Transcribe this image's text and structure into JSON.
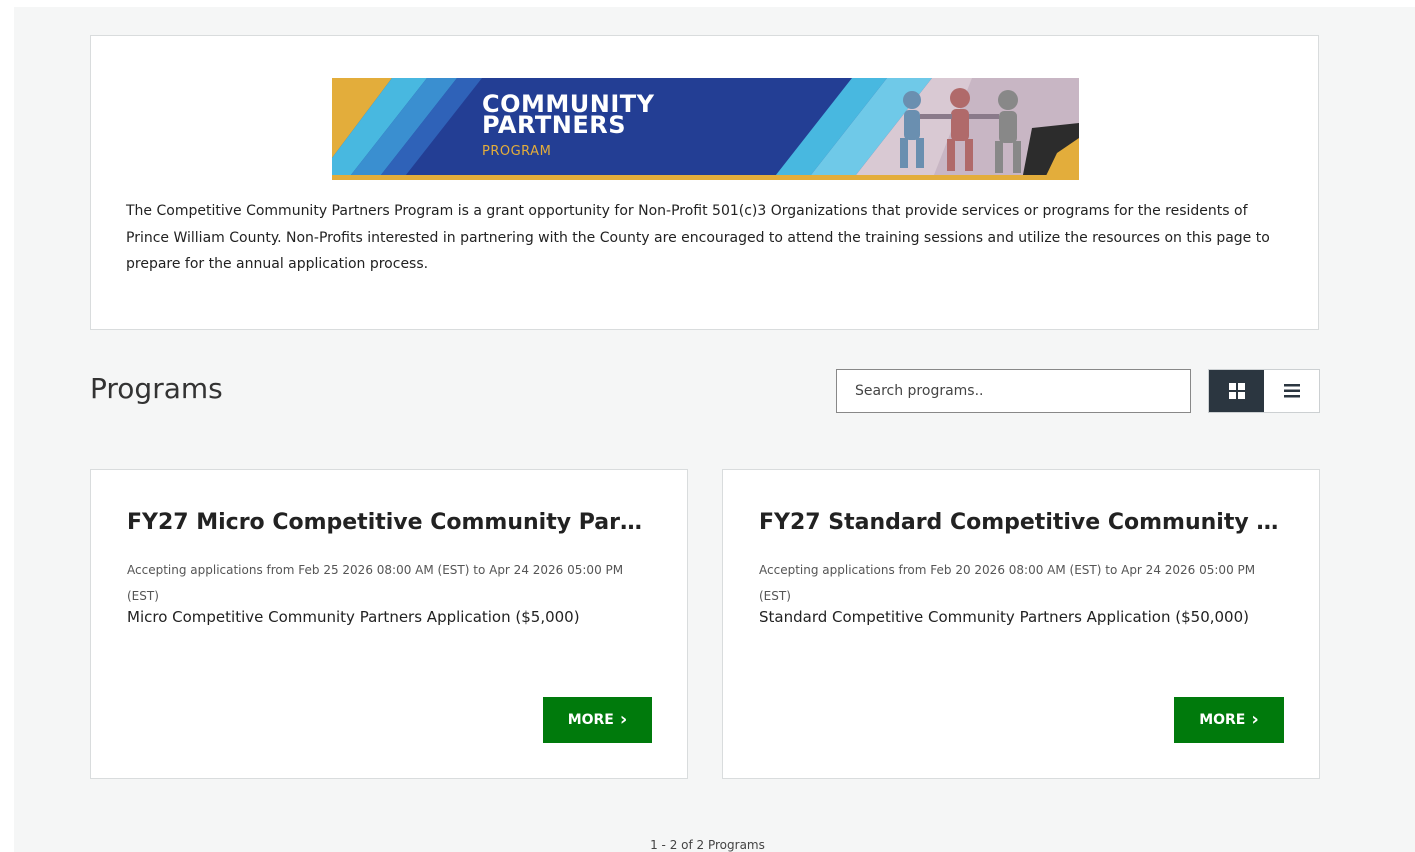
{
  "banner": {
    "title_line1": "COMMUNITY",
    "title_line2": "PARTNERS",
    "subtitle": "PROGRAM",
    "colors": {
      "navy": "#233e94",
      "gold": "#e3ad3b",
      "light_blue": "#48b8e0"
    }
  },
  "intro": {
    "text": "The Competitive Community Partners Program is a grant opportunity for Non-Profit 501(c)3 Organizations that provide services or programs for the residents of Prince William County. Non-Profits interested in partnering with the County are encouraged to attend the training sessions and utilize the resources on this page to prepare for the annual application process."
  },
  "programs": {
    "heading": "Programs",
    "search_placeholder": "Search programs..",
    "view_modes": [
      {
        "name": "grid",
        "icon": "grid-icon",
        "active": true
      },
      {
        "name": "list",
        "icon": "list-icon",
        "active": false
      }
    ],
    "cards": [
      {
        "title": "FY27 Micro Competitive Community Part...",
        "dates": "Accepting applications from Feb 25 2026 08:00 AM (EST) to Apr 24 2026 05:00 PM (EST)",
        "description": "Micro Competitive Community Partners Application ($5,000)",
        "button": "MORE"
      },
      {
        "title": "FY27 Standard Competitive Community P...",
        "dates": "Accepting applications from Feb 20 2026 08:00 AM (EST) to Apr 24 2026 05:00 PM (EST)",
        "description": "Standard Competitive Community Partners Application ($50,000)",
        "button": "MORE"
      }
    ],
    "pager": "1 - 2 of 2 Programs",
    "accent_color": "#007a0c"
  }
}
